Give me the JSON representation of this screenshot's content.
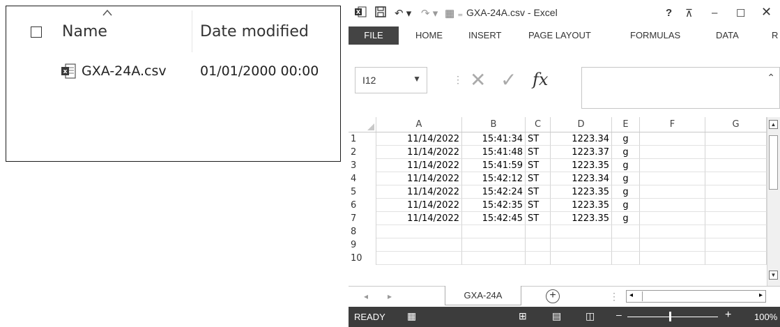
{
  "explorer": {
    "col_name": "Name",
    "col_date": "Date modified",
    "file": {
      "name": "GXA-24A.csv",
      "date": "01/01/2000 00:00",
      "icon": "excel-csv-file-icon"
    }
  },
  "excel": {
    "title": "GXA-24A.csv - Excel",
    "ribbon_tabs": [
      "FILE",
      "HOME",
      "INSERT",
      "PAGE LAYOUT",
      "FORMULAS",
      "DATA",
      "R"
    ],
    "name_box": "I12",
    "fx": "fx",
    "columns": [
      "A",
      "B",
      "C",
      "D",
      "E",
      "F",
      "G"
    ],
    "row_numbers": [
      "1",
      "2",
      "3",
      "4",
      "5",
      "6",
      "7",
      "8",
      "9",
      "10"
    ],
    "rows": [
      [
        "11/14/2022",
        "15:41:34",
        "ST",
        "1223.34",
        "g"
      ],
      [
        "11/14/2022",
        "15:41:48",
        "ST",
        "1223.37",
        "g"
      ],
      [
        "11/14/2022",
        "15:41:59",
        "ST",
        "1223.35",
        "g"
      ],
      [
        "11/14/2022",
        "15:42:12",
        "ST",
        "1223.34",
        "g"
      ],
      [
        "11/14/2022",
        "15:42:24",
        "ST",
        "1223.35",
        "g"
      ],
      [
        "11/14/2022",
        "15:42:35",
        "ST",
        "1223.35",
        "g"
      ],
      [
        "11/14/2022",
        "15:42:45",
        "ST",
        "1223.35",
        "g"
      ]
    ],
    "sheet_tab": "GXA-24A",
    "status": "READY",
    "zoom": "100%",
    "colors": {
      "file_tab": "#444444",
      "status_bar": "#3c3c3c"
    }
  }
}
